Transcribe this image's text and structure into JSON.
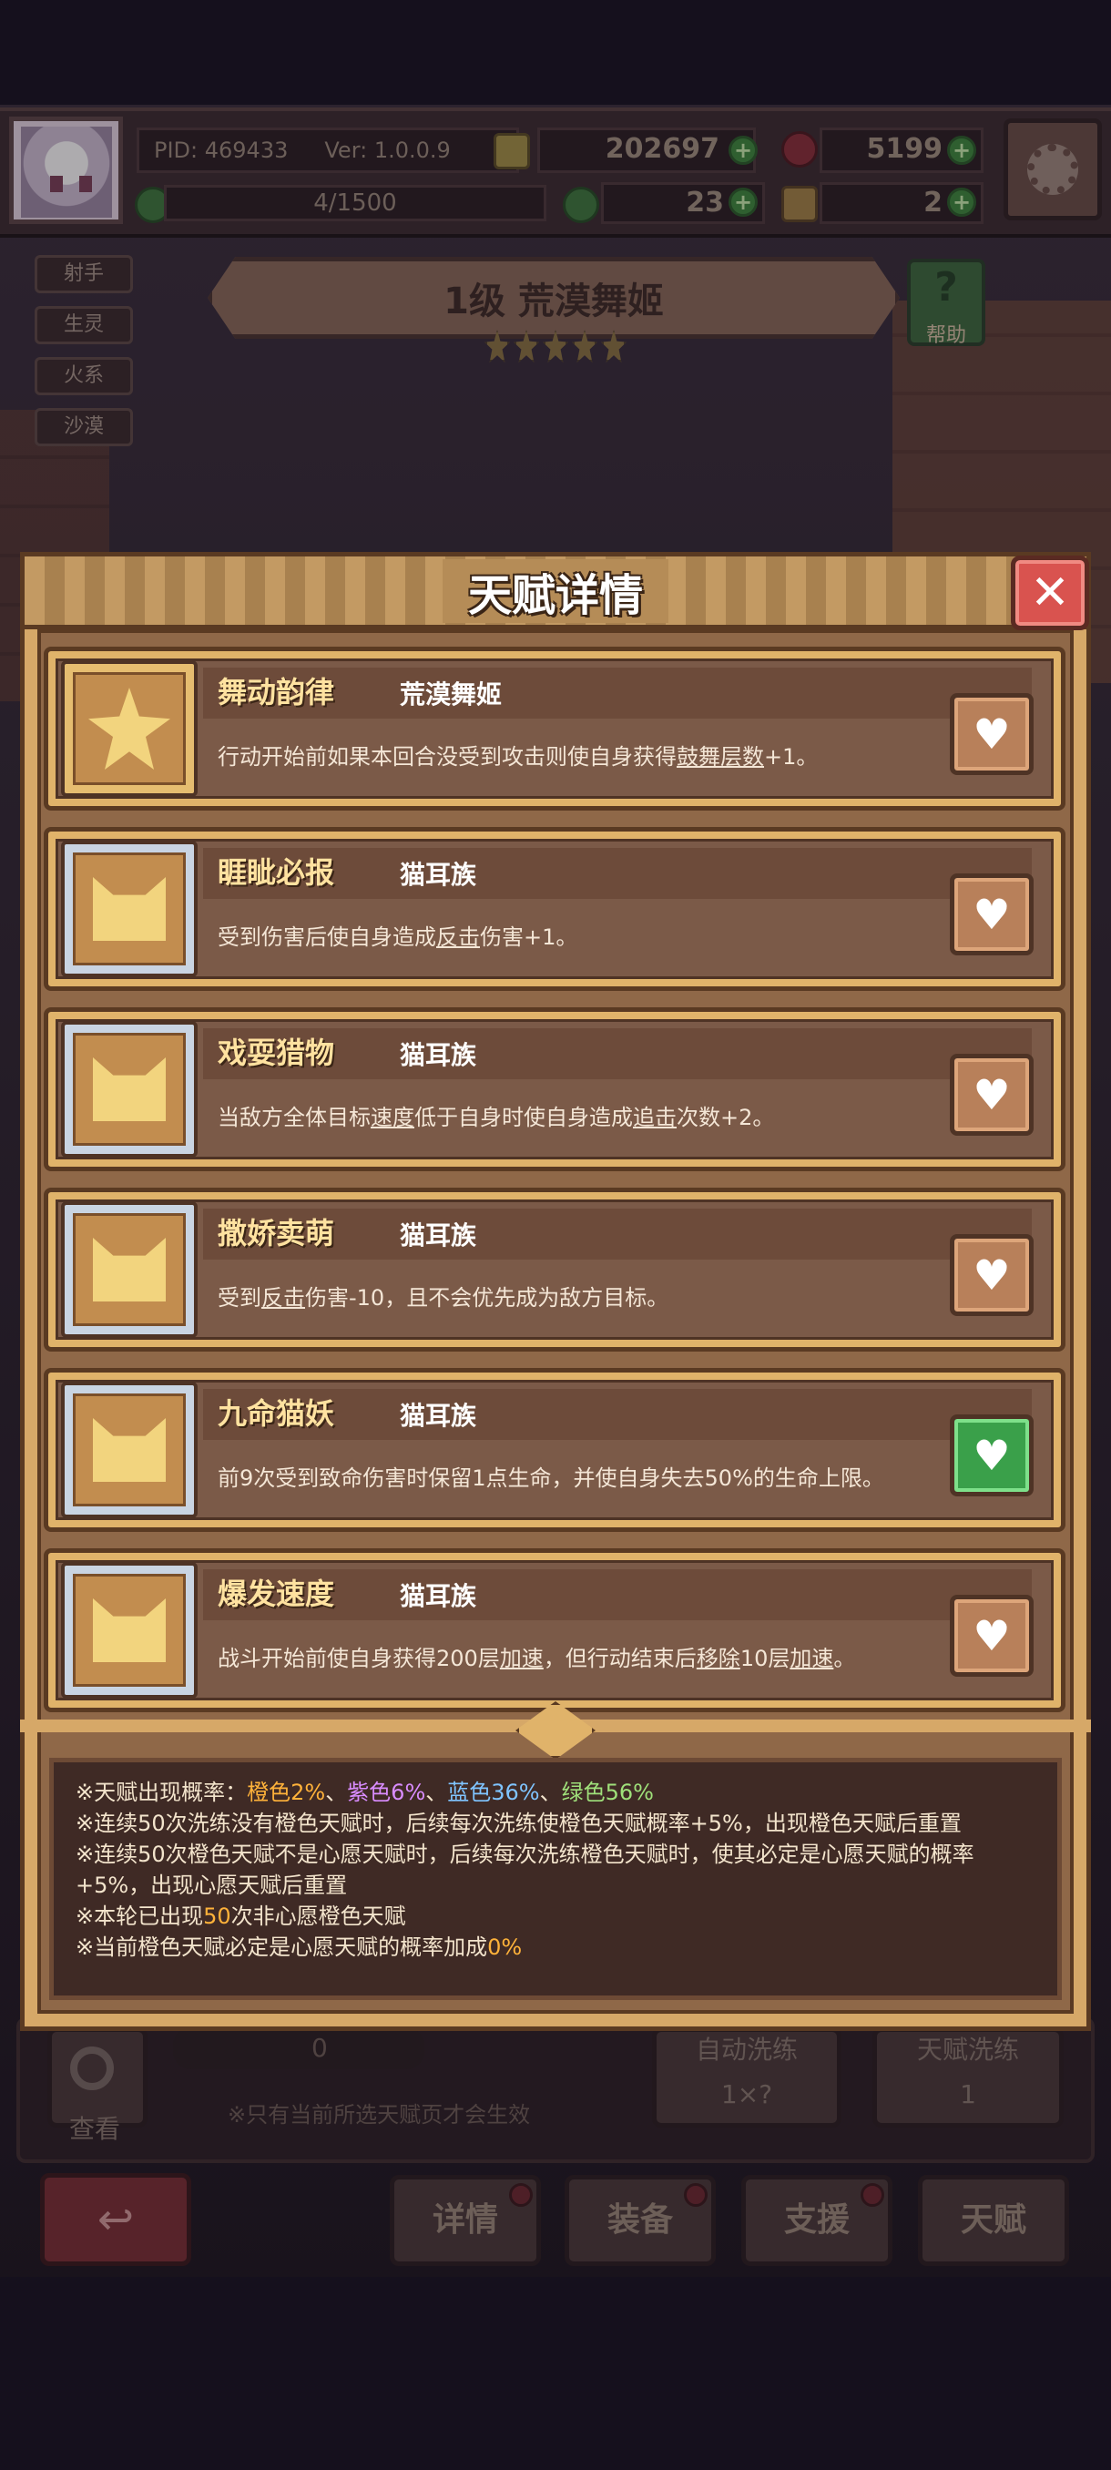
{
  "topbar": {
    "pid": "PID: 469433",
    "ver": "Ver: 1.0.0.9",
    "gold": "202697",
    "gems": "5199",
    "exp": "4/1500",
    "clover": "23",
    "scroll": "2"
  },
  "tags": [
    "射手",
    "生灵",
    "火系",
    "沙漠"
  ],
  "hero": {
    "name": "1级 荒漠舞姬",
    "help_label": "帮助",
    "help_glyph": "?"
  },
  "modal": {
    "title": "天赋详情",
    "close_glyph": "✕",
    "talents": [
      {
        "name": "舞动韵律",
        "source": "荒漠舞姬",
        "icon": "star-icon",
        "frame": "gold",
        "desc_a": "行动开始前如果本回合没受到攻击则使自身获得",
        "desc_k1": "鼓舞层数",
        "desc_b": "+1。",
        "desc_k2": "",
        "desc_c": "",
        "desc_k3": "",
        "desc_d": "",
        "wish": false
      },
      {
        "name": "睚眦必报",
        "source": "猫耳族",
        "icon": "cat-icon",
        "frame": "silver",
        "desc_a": "受到伤害后使自身造成",
        "desc_k1": "反击",
        "desc_b": "伤害+1。",
        "desc_k2": "",
        "desc_c": "",
        "desc_k3": "",
        "desc_d": "",
        "wish": false
      },
      {
        "name": "戏耍猎物",
        "source": "猫耳族",
        "icon": "cat-icon",
        "frame": "silver",
        "desc_a": "当敌方全体目标",
        "desc_k1": "速度",
        "desc_b": "低于自身时使自身造成",
        "desc_k2": "追击",
        "desc_c": "次数+2。",
        "desc_k3": "",
        "desc_d": "",
        "wish": false
      },
      {
        "name": "撒娇卖萌",
        "source": "猫耳族",
        "icon": "cat-icon",
        "frame": "silver",
        "desc_a": "受到",
        "desc_k1": "反击",
        "desc_b": "伤害-10，且不会优先成为敌方目标。",
        "desc_k2": "",
        "desc_c": "",
        "desc_k3": "",
        "desc_d": "",
        "wish": false
      },
      {
        "name": "九命猫妖",
        "source": "猫耳族",
        "icon": "cat-icon",
        "frame": "silver",
        "desc_a": "前9次受到致命伤害时保留1点生命，并使自身失去50%的生命上限。",
        "desc_k1": "",
        "desc_b": "",
        "desc_k2": "",
        "desc_c": "",
        "desc_k3": "",
        "desc_d": "",
        "wish": true
      },
      {
        "name": "爆发速度",
        "source": "猫耳族",
        "icon": "cat-icon",
        "frame": "silver",
        "desc_a": "战斗开始前使自身获得200层",
        "desc_k1": "加速",
        "desc_b": "，但行动结束后",
        "desc_k2": "移除",
        "desc_c": "10层",
        "desc_k3": "加速",
        "desc_d": "。",
        "wish": false
      }
    ],
    "info": {
      "l1_prefix": "※天赋出现概率：",
      "orange": "橙色2%",
      "sep1": "、",
      "purple": "紫色6%",
      "sep2": "、",
      "blue": "蓝色36%",
      "sep3": "、",
      "green": "绿色56%",
      "l2": "※连续50次洗练没有橙色天赋时，后续每次洗练使橙色天赋概率+5%，出现橙色天赋后重置",
      "l3": "※连续50次橙色天赋不是心愿天赋时，后续每次洗练橙色天赋时，使其必定是心愿天赋的概率+5%，出现心愿天赋后重置",
      "l4_a": "※本轮已出现",
      "l4_num": "50",
      "l4_b": "次非心愿橙色天赋",
      "l5_a": "※当前橙色天赋必定是心愿天赋的概率加成",
      "l5_num": "0%"
    }
  },
  "background_ui": {
    "count": "0",
    "auto_label": "自动洗练",
    "auto_value": "1×?",
    "talent_label": "天赋洗练",
    "talent_value": "1",
    "search_label": "查看",
    "note": "※只有当前所选天赋页才会生效",
    "nav": [
      "详情",
      "装备",
      "支援",
      "天赋"
    ],
    "back_glyph": "↩"
  },
  "colors": {
    "orange": "#ffb23a",
    "purple": "#d98cff",
    "blue": "#7fc4ff",
    "green": "#9fe07a",
    "wish_on": "#3aa04a"
  }
}
